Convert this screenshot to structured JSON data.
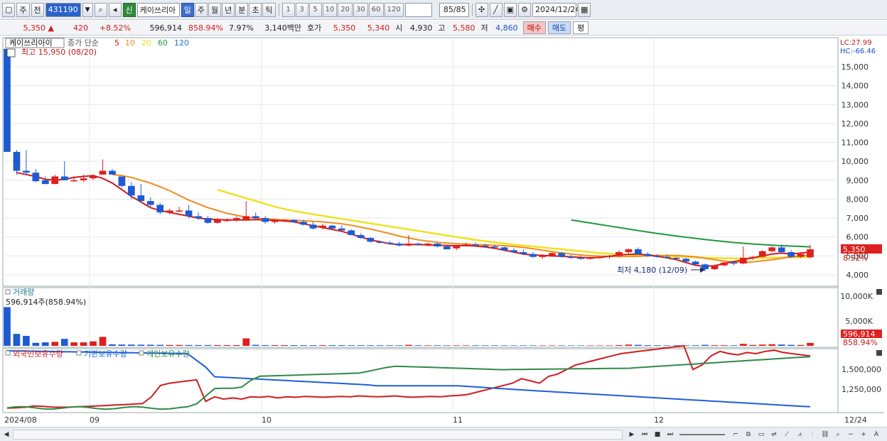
{
  "toolbar": {
    "menu1": "주",
    "menu2": "전",
    "code": "431190",
    "stock_badge": "신",
    "stock_name": "케이쓰리아",
    "periods": [
      "일",
      "주",
      "월",
      "년",
      "분",
      "초",
      "틱"
    ],
    "active_period": "일",
    "intervals": [
      "1",
      "3",
      "5",
      "10",
      "20",
      "30",
      "60",
      "120"
    ],
    "count": "85/85",
    "date": "2024/12/24"
  },
  "quote": {
    "price": "5,350",
    "change": "420",
    "change_pct": "+8.52%",
    "volume": "596,914",
    "volume_pct": "858.94%",
    "turnover_pct": "7.97%",
    "amount": "3,140백만",
    "bid_label": "호가",
    "ask": "5,350",
    "bid": "5,340",
    "open_label": "시",
    "open": "4,930",
    "high_label": "고",
    "high": "5,580",
    "low_label": "저",
    "low": "4,860",
    "buy_label": "매수",
    "sell_label": "매도",
    "eval_label": "평"
  },
  "price_panel": {
    "stock_tag": "케이쓰리아이",
    "ma_label": "종가 단순",
    "ma_periods": [
      "5",
      "10",
      "20",
      "60",
      "120"
    ],
    "ma_colors": [
      "#d01c1c",
      "#f08c1e",
      "#f0e21e",
      "#1e9a3c",
      "#1e6fd6"
    ],
    "high_annotation": "최고 15,950 (08/20)",
    "low_annotation": "최저 4,180 (12/09)",
    "lc": "LC:27.99",
    "hc": "HC:-66.46",
    "price_tag": "5,350",
    "pct_tag": "8.52%"
  },
  "volume_panel": {
    "title": "거래량",
    "current": "596,914주(858.94%)",
    "tag_value": "596,914",
    "tag_pct": "858.94%"
  },
  "holding_panel": {
    "series": [
      "외국인보유수량",
      "기관보유수량",
      "개인보유수량"
    ],
    "colors": [
      "#d01c1c",
      "#1e5fd6",
      "#2f8a4a"
    ]
  },
  "x_axis": {
    "labels": [
      "2024/08",
      "09",
      "10",
      "11",
      "12",
      "12/24"
    ]
  },
  "chart_data": [
    {
      "type": "candlestick",
      "ylim": [
        3700,
        16200
      ],
      "yticks": [
        "15,000",
        "14,000",
        "13,000",
        "12,000",
        "11,000",
        "10,000",
        "9,000",
        "8,000",
        "7,000",
        "6,000",
        "5,000",
        "4,000"
      ],
      "candles": [
        [
          15950,
          15950,
          10500,
          10500
        ],
        [
          10500,
          10600,
          9300,
          9500
        ],
        [
          9500,
          10600,
          9300,
          9400
        ],
        [
          9400,
          9600,
          8900,
          8950
        ],
        [
          9000,
          9200,
          8800,
          8800
        ],
        [
          8800,
          9300,
          8800,
          9200
        ],
        [
          9200,
          10000,
          9000,
          9000
        ],
        [
          9000,
          9200,
          8900,
          9000
        ],
        [
          9000,
          9300,
          8900,
          9100
        ],
        [
          9100,
          9300,
          9000,
          9200
        ],
        [
          9300,
          10100,
          9300,
          9500
        ],
        [
          9500,
          9600,
          9300,
          9300
        ],
        [
          9200,
          9200,
          8600,
          8700
        ],
        [
          8700,
          8900,
          8000,
          8200
        ],
        [
          8200,
          8800,
          8000,
          7900
        ],
        [
          7900,
          8100,
          7600,
          7700
        ],
        [
          7700,
          7800,
          7200,
          7300
        ],
        [
          7300,
          7500,
          7200,
          7400
        ],
        [
          7400,
          7600,
          7300,
          7400
        ],
        [
          7400,
          7700,
          7000,
          7100
        ],
        [
          7100,
          7300,
          6900,
          7000
        ],
        [
          7000,
          7100,
          6700,
          6750
        ],
        [
          6750,
          7000,
          6700,
          6950
        ],
        [
          6900,
          7000,
          6800,
          6900
        ],
        [
          6900,
          7100,
          6800,
          7000
        ],
        [
          6900,
          7900,
          6900,
          7100
        ],
        [
          7100,
          7300,
          6900,
          7000
        ],
        [
          7000,
          7100,
          6700,
          6800
        ],
        [
          6800,
          6900,
          6700,
          6850
        ],
        [
          6850,
          6950,
          6800,
          6900
        ],
        [
          6900,
          6950,
          6750,
          6800
        ],
        [
          6800,
          6900,
          6600,
          6650
        ],
        [
          6650,
          6800,
          6400,
          6450
        ],
        [
          6500,
          6700,
          6400,
          6600
        ],
        [
          6600,
          6650,
          6400,
          6450
        ],
        [
          6450,
          6600,
          6300,
          6350
        ],
        [
          6350,
          6400,
          6100,
          6100
        ],
        [
          6100,
          6200,
          5900,
          5950
        ],
        [
          5950,
          6000,
          5700,
          5750
        ],
        [
          5750,
          5800,
          5650,
          5700
        ],
        [
          5700,
          5800,
          5600,
          5650
        ],
        [
          5650,
          5750,
          5500,
          5550
        ],
        [
          5550,
          6100,
          5500,
          5650
        ],
        [
          5650,
          5700,
          5550,
          5600
        ],
        [
          5600,
          5700,
          5500,
          5650
        ],
        [
          5650,
          5700,
          5450,
          5500
        ],
        [
          5500,
          5600,
          5350,
          5350
        ],
        [
          5400,
          5600,
          5300,
          5550
        ],
        [
          5550,
          5700,
          5500,
          5600
        ],
        [
          5600,
          5700,
          5500,
          5550
        ],
        [
          5550,
          5650,
          5450,
          5500
        ],
        [
          5500,
          5600,
          5400,
          5450
        ],
        [
          5450,
          5500,
          5250,
          5300
        ],
        [
          5300,
          5400,
          5150,
          5200
        ],
        [
          5200,
          5350,
          5050,
          5100
        ],
        [
          5100,
          5200,
          4900,
          4950
        ],
        [
          4950,
          5100,
          4850,
          5000
        ],
        [
          5000,
          5200,
          4950,
          5150
        ],
        [
          5150,
          5200,
          4900,
          4950
        ],
        [
          4950,
          5050,
          4850,
          4900
        ],
        [
          4900,
          5000,
          4800,
          4850
        ],
        [
          4850,
          4950,
          4800,
          4900
        ],
        [
          4900,
          5000,
          4850,
          4950
        ],
        [
          4950,
          5050,
          4850,
          5000
        ],
        [
          5000,
          5300,
          4950,
          5200
        ],
        [
          5200,
          5400,
          5100,
          5350
        ],
        [
          5350,
          5450,
          5050,
          5100
        ],
        [
          5100,
          5200,
          4950,
          5000
        ],
        [
          5000,
          5100,
          4900,
          4950
        ],
        [
          4950,
          5050,
          4850,
          4900
        ],
        [
          4900,
          4950,
          4800,
          4850
        ],
        [
          4850,
          4900,
          4650,
          4700
        ],
        [
          4700,
          4750,
          4500,
          4550
        ],
        [
          4550,
          4600,
          4180,
          4300
        ],
        [
          4300,
          4550,
          4250,
          4500
        ],
        [
          4500,
          4700,
          4450,
          4650
        ],
        [
          4650,
          4700,
          4500,
          4600
        ],
        [
          4600,
          5500,
          4550,
          4900
        ],
        [
          4900,
          5000,
          4800,
          4950
        ],
        [
          4950,
          5300,
          4900,
          5250
        ],
        [
          5250,
          5500,
          5200,
          5450
        ],
        [
          5450,
          5600,
          5150,
          5200
        ],
        [
          5200,
          5300,
          4900,
          4950
        ],
        [
          4950,
          5200,
          4900,
          5100
        ],
        [
          4930,
          5580,
          4860,
          5350
        ]
      ],
      "ma5": [
        9400,
        9300,
        9200,
        9050,
        9000,
        9050,
        9150,
        9200,
        9250,
        9100,
        8850,
        8500,
        8150,
        7850,
        7550,
        7400,
        7300,
        7200,
        7100,
        7000,
        6950,
        6920,
        6900,
        6900,
        6900,
        6920,
        6900,
        6880,
        6850,
        6800,
        6700,
        6600,
        6500,
        6400,
        6300,
        6150,
        6000,
        5850,
        5750,
        5650,
        5600,
        5600,
        5600,
        5580,
        5560,
        5550,
        5540,
        5550,
        5520,
        5470,
        5400,
        5300,
        5200,
        5100,
        5050,
        5020,
        5000,
        4980,
        4950,
        4920,
        4900,
        4920,
        4980,
        5050,
        5080,
        5100,
        5050,
        4980,
        4900,
        4800,
        4650,
        4500,
        4450,
        4480,
        4600,
        4700,
        4800,
        4900,
        5000,
        5100,
        5150,
        5100,
        5150,
        5200
      ],
      "ma10": [
        9300,
        9250,
        9150,
        9000,
        8850,
        8650,
        8450,
        8200,
        7950,
        7750,
        7550,
        7400,
        7250,
        7150,
        7050,
        7000,
        6960,
        6930,
        6900,
        6880,
        6860,
        6830,
        6800,
        6750,
        6700,
        6620,
        6520,
        6420,
        6300,
        6180,
        6050,
        5950,
        5850,
        5780,
        5720,
        5680,
        5650,
        5620,
        5600,
        5580,
        5560,
        5540,
        5500,
        5450,
        5380,
        5300,
        5230,
        5160,
        5100,
        5050,
        5010,
        4990,
        4980,
        4970,
        4970,
        4980,
        5000,
        5020,
        5030,
        5020,
        4990,
        4950,
        4880,
        4800,
        4730,
        4680,
        4660,
        4680,
        4740,
        4800,
        4880,
        4950,
        5000,
        5050
      ],
      "ma20": [
        8500,
        8350,
        8200,
        8050,
        7900,
        7750,
        7600,
        7480,
        7380,
        7290,
        7200,
        7120,
        7040,
        6960,
        6880,
        6800,
        6720,
        6640,
        6560,
        6480,
        6400,
        6320,
        6240,
        6160,
        6080,
        6000,
        5920,
        5850,
        5780,
        5720,
        5660,
        5600,
        5550,
        5500,
        5450,
        5400,
        5350,
        5300,
        5250,
        5200,
        5150,
        5120,
        5090,
        5070,
        5050,
        5030,
        5010,
        4990,
        4970,
        4950,
        4920,
        4900,
        4890,
        4880,
        4870,
        4870,
        4880,
        4890,
        4900,
        4910,
        4920,
        4930,
        4950
      ],
      "ma60": [
        6900,
        6820,
        6740,
        6660,
        6580,
        6500,
        6420,
        6340,
        6260,
        6190,
        6120,
        6050,
        5990,
        5930,
        5870,
        5810,
        5760,
        5710,
        5670,
        5630,
        5600,
        5570,
        5540,
        5520,
        5500,
        5480
      ]
    },
    {
      "type": "bar",
      "title": "거래량",
      "yticks": [
        "10,000K",
        "10,000K",
        "5,000K"
      ],
      "values": [
        7800,
        2400,
        2000,
        600,
        700,
        800,
        1400,
        700,
        700,
        900,
        1800,
        300,
        260,
        250,
        230,
        220,
        200,
        180,
        180,
        170,
        160,
        160,
        150,
        150,
        150,
        1500,
        200,
        150,
        140,
        140,
        130,
        130,
        130,
        130,
        125,
        125,
        120,
        120,
        115,
        115,
        110,
        110,
        200,
        110,
        105,
        105,
        100,
        100,
        100,
        100,
        95,
        95,
        95,
        90,
        90,
        90,
        90,
        90,
        90,
        85,
        85,
        85,
        85,
        85,
        150,
        250,
        200,
        130,
        110,
        100,
        95,
        95,
        110,
        200,
        130,
        120,
        110,
        400,
        180,
        260,
        320,
        260,
        200,
        180,
        597
      ]
    },
    {
      "type": "line",
      "yticks": [
        "1,500,000",
        "1,250,000"
      ],
      "series": [
        {
          "name": "외국인보유수량",
          "values": [
            10,
            12,
            14,
            20,
            18,
            15,
            14,
            15,
            17,
            18,
            20,
            22,
            24,
            26,
            28,
            30,
            60,
            110,
            120,
            125,
            130,
            135,
            40,
            60,
            50,
            55,
            50,
            60,
            58,
            62,
            55,
            60,
            58,
            62,
            60,
            58,
            60,
            62,
            60,
            64,
            62,
            60,
            62,
            64,
            60,
            58,
            60,
            62,
            60,
            64,
            66,
            70,
            80,
            90,
            100,
            110,
            120,
            140,
            130,
            120,
            150,
            160,
            180,
            200,
            210,
            220,
            230,
            240,
            250,
            255,
            260,
            265,
            270,
            275,
            280,
            285,
            180,
            200,
            240,
            260,
            250,
            245,
            255,
            250,
            260,
            265,
            255,
            250,
            245,
            240
          ]
        }
      ]
    }
  ]
}
